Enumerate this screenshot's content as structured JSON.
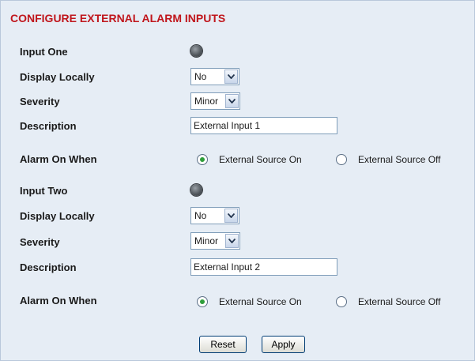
{
  "title": "CONFIGURE EXTERNAL ALARM INPUTS",
  "inputs": [
    {
      "name_label": "Input One",
      "display_locally_label": "Display Locally",
      "display_locally_value": "No",
      "severity_label": "Severity",
      "severity_value": "Minor",
      "description_label": "Description",
      "description_value": "External Input 1",
      "alarm_on_when_label": "Alarm On When",
      "option_on": "External Source On",
      "option_off": "External Source Off",
      "selected": "on"
    },
    {
      "name_label": "Input Two",
      "display_locally_label": "Display Locally",
      "display_locally_value": "No",
      "severity_label": "Severity",
      "severity_value": "Minor",
      "description_label": "Description",
      "description_value": "External Input 2",
      "alarm_on_when_label": "Alarm On When",
      "option_on": "External Source On",
      "option_off": "External Source Off",
      "selected": "on"
    }
  ],
  "buttons": {
    "reset": "Reset",
    "apply": "Apply"
  },
  "colors": {
    "title": "#c0161c",
    "panel_bg": "#e6edf5",
    "radio_selected": "#2f9e3b"
  },
  "icons": {
    "status": "status-led-icon",
    "dropdown": "chevron-down-icon"
  }
}
